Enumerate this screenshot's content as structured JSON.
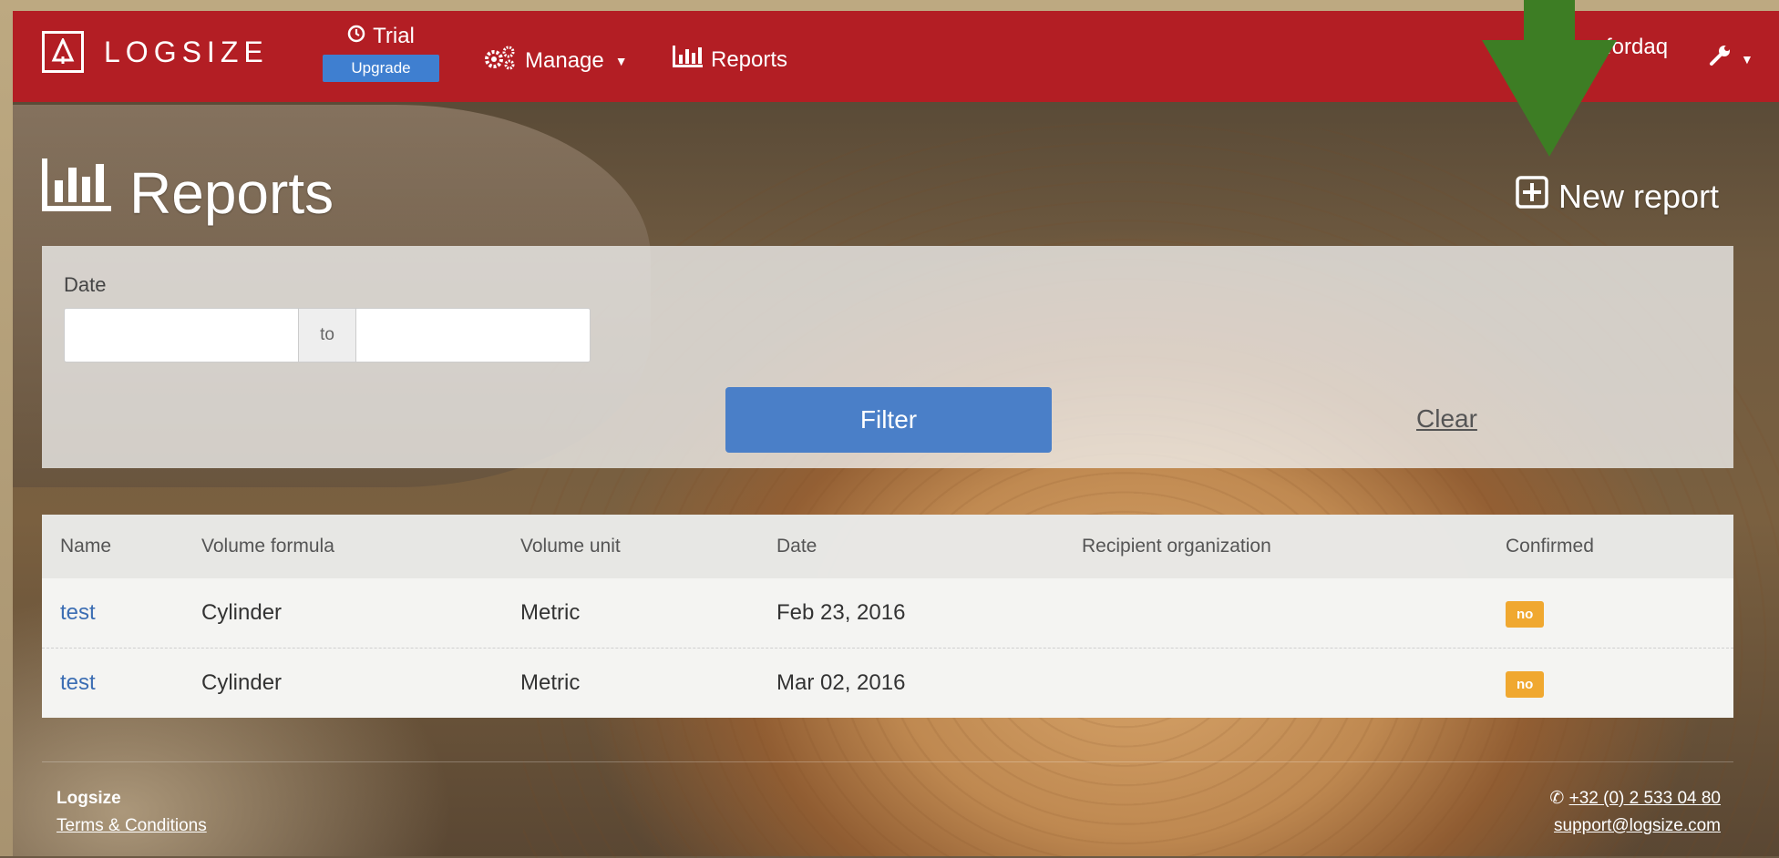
{
  "navbar": {
    "brand": "LOGSIZE",
    "trial_label": "Trial",
    "upgrade_label": "Upgrade",
    "manage_label": "Manage",
    "reports_label": "Reports",
    "user_label": "fordaq",
    "colors": {
      "bar": "#b31e24",
      "upgrade": "#3f7fd0"
    }
  },
  "page": {
    "title": "Reports",
    "new_report_label": "New report"
  },
  "filter": {
    "date_label": "Date",
    "from_value": "",
    "to_addon": "to",
    "to_value": "",
    "filter_button": "Filter",
    "clear_link": "Clear"
  },
  "table": {
    "headers": {
      "name": "Name",
      "volume_formula": "Volume formula",
      "volume_unit": "Volume unit",
      "date": "Date",
      "recipient_organization": "Recipient organization",
      "confirmed": "Confirmed"
    },
    "rows": [
      {
        "name": "test",
        "volume_formula": "Cylinder",
        "volume_unit": "Metric",
        "date": "Feb 23, 2016",
        "recipient_organization": "",
        "confirmed": "no"
      },
      {
        "name": "test",
        "volume_formula": "Cylinder",
        "volume_unit": "Metric",
        "date": "Mar 02, 2016",
        "recipient_organization": "",
        "confirmed": "no"
      }
    ]
  },
  "footer": {
    "company": "Logsize",
    "terms": "Terms & Conditions",
    "phone": "+32 (0) 2 533 04 80",
    "email": "support@logsize.com"
  }
}
